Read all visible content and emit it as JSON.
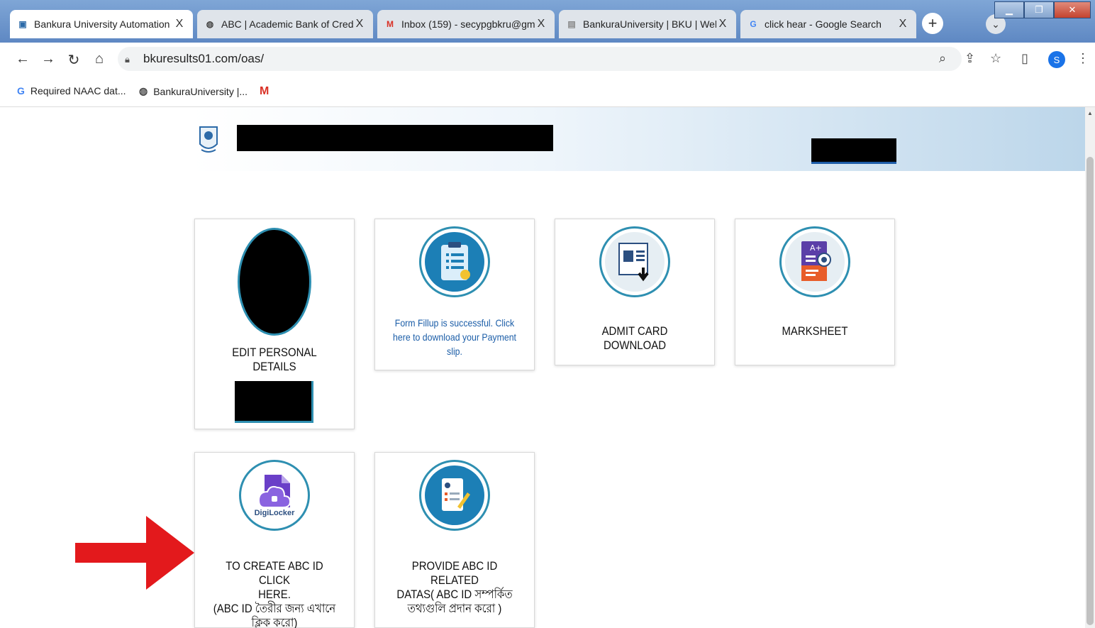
{
  "browser": {
    "tabs": [
      {
        "title": "Bankura University Automation",
        "icon": "university-logo-icon",
        "active": true
      },
      {
        "title": "ABC | Academic Bank of Credit",
        "icon": "globe-icon",
        "active": false
      },
      {
        "title": "Inbox (159) - secypgbkru@gm",
        "icon": "gmail-icon",
        "active": false
      },
      {
        "title": "BankuraUniversity | BKU | Welc",
        "icon": "site-icon",
        "active": false
      },
      {
        "title": "click hear - Google Search",
        "icon": "google-icon",
        "active": false
      }
    ],
    "close_glyph": "X",
    "new_tab_glyph": "+",
    "url": "bkuresults01.com/oas/",
    "profile_initial": "S",
    "bookmarks": [
      {
        "label": "Required NAAC dat...",
        "icon": "google-icon"
      },
      {
        "label": "BankuraUniversity |...",
        "icon": "globe-icon"
      },
      {
        "label": "",
        "icon": "gmail-icon"
      }
    ]
  },
  "cards": {
    "edit_personal": {
      "label": "EDIT PERSONAL DETAILS"
    },
    "form_fillup": {
      "label": "Form Fillup is successful. Click here to download your Payment slip."
    },
    "admit_card": {
      "label": "ADMIT CARD DOWNLOAD"
    },
    "marksheet": {
      "label": "MARKSHEET"
    },
    "create_abc": {
      "line1": "TO CREATE ABC ID CLICK",
      "line2": "HERE.",
      "line3": "(ABC ID তৈরীর জন্য এখানে",
      "line4": "ক্লিক করো)",
      "badge": "DigiLocker"
    },
    "provide_abc": {
      "line1": "PROVIDE ABC ID RELATED",
      "line2": "DATAS( ABC ID সম্পর্কিত",
      "line3": "তথ্যগুলি প্রদান করো )"
    }
  },
  "colors": {
    "accent": "#2e8fb1",
    "arrow": "#e3191c",
    "link": "#1c5ea8"
  }
}
